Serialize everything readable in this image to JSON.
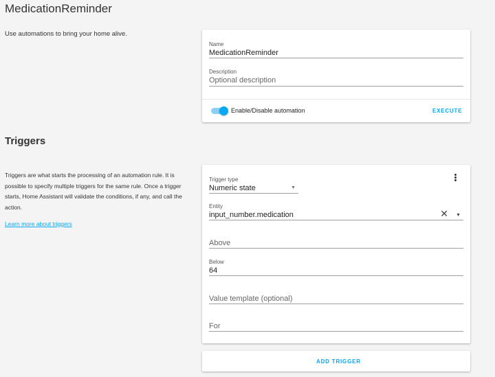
{
  "header": {
    "title": "MedicationReminder",
    "intro": "Use automations to bring your home alive."
  },
  "info_card": {
    "name_label": "Name",
    "name_value": "MedicationReminder",
    "description_label": "Description",
    "description_placeholder": "Optional description",
    "toggle_label": "Enable/Disable automation",
    "toggle_on": true,
    "execute_label": "EXECUTE"
  },
  "triggers": {
    "title": "Triggers",
    "description": "Triggers are what starts the processing of an automation rule. It is possible to specify multiple triggers for the same rule. Once a trigger starts, Home Assistant will validate the conditions, if any, and call the action.",
    "learn_more": "Learn more about triggers",
    "card": {
      "trigger_type_label": "Trigger type",
      "trigger_type_value": "Numeric state",
      "entity_label": "Entity",
      "entity_value": "input_number.medication",
      "above_placeholder": "Above",
      "below_label": "Below",
      "below_value": "64",
      "value_template_placeholder": "Value template (optional)",
      "for_placeholder": "For"
    },
    "add_trigger_label": "ADD TRIGGER"
  },
  "icons": {
    "menu": "more-vert-icon",
    "clear": "close-icon",
    "dropdown": "arrow-drop-down-icon"
  },
  "colors": {
    "accent": "#03a9f4",
    "background": "#f4f4f4"
  }
}
